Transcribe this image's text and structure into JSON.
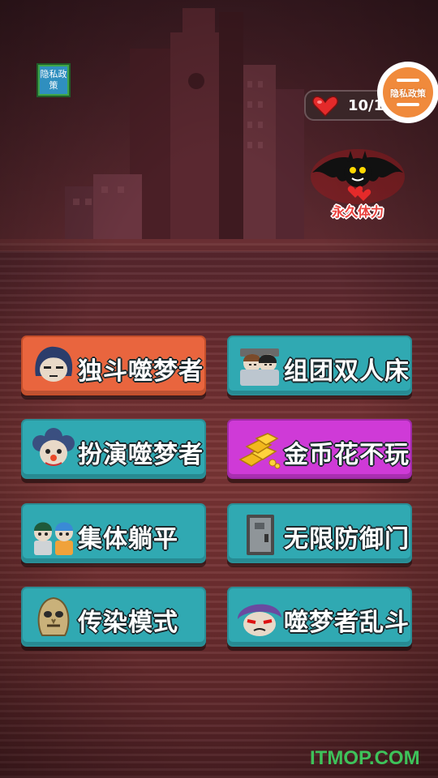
{
  "header": {
    "privacy_small_label": "隐私政策",
    "energy_text": "10/1",
    "privacy_circle_label": "隐私政策",
    "permanent_energy_label": "永久体力"
  },
  "modes": [
    {
      "label": "独斗噬梦者",
      "icon": "girl-face-icon",
      "color": "#e9653e"
    },
    {
      "label": "组团双人床",
      "icon": "couple-in-bed-icon",
      "color": "#30a9b2"
    },
    {
      "label": "扮演噬梦者",
      "icon": "clown-face-icon",
      "color": "#30a9b2"
    },
    {
      "label": "金币花不玩",
      "icon": "gold-bars-icon",
      "color": "#cf3ad7"
    },
    {
      "label": "集体躺平",
      "icon": "group-kids-icon",
      "color": "#30a9b2"
    },
    {
      "label": "无限防御门",
      "icon": "metal-door-icon",
      "color": "#30a9b2"
    },
    {
      "label": "传染模式",
      "icon": "zombie-head-icon",
      "color": "#30a9b2"
    },
    {
      "label": "噬梦者乱斗",
      "icon": "angry-face-icon",
      "color": "#30a9b2"
    }
  ],
  "watermark": "ITMOP.COM"
}
